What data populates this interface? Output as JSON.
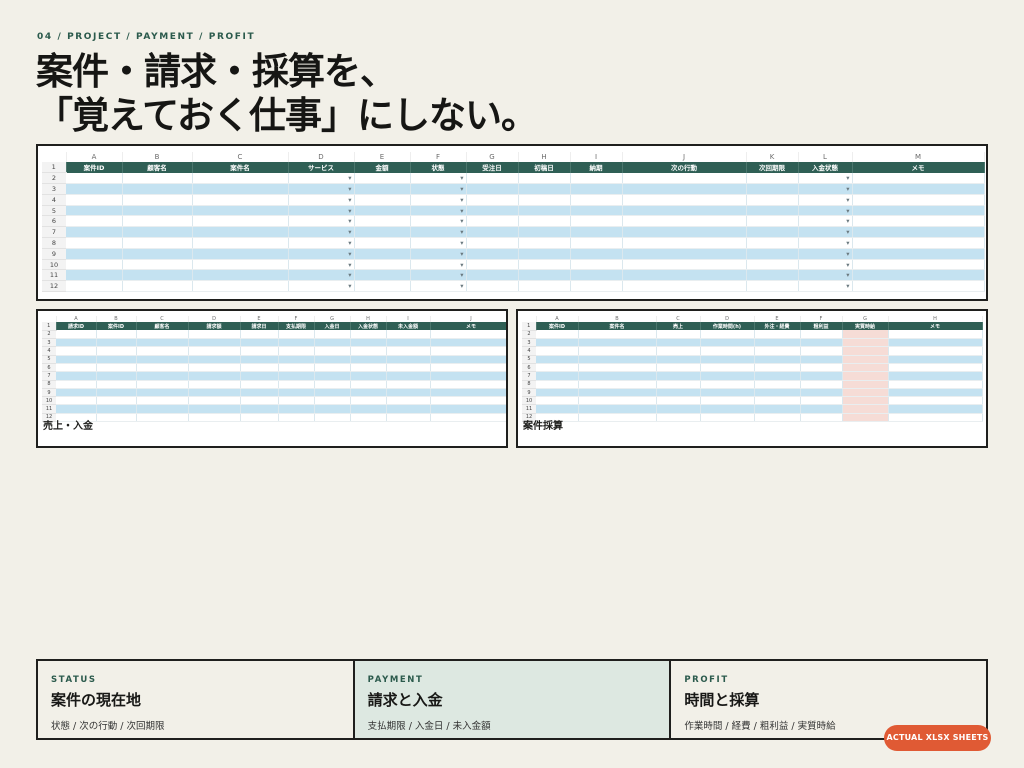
{
  "eyebrow": "04 / PROJECT / PAYMENT / PROFIT",
  "title": {
    "line1": "案件・請求・採算を、",
    "line2": "「覚えておく仕事」にしない。"
  },
  "main_sheet": {
    "column_letters": [
      "A",
      "B",
      "C",
      "D",
      "E",
      "F",
      "G",
      "H",
      "I",
      "J",
      "K",
      "L",
      "M"
    ],
    "headers": [
      "案件ID",
      "顧客名",
      "案件名",
      "サービス",
      "金額",
      "状態",
      "受注日",
      "初稿日",
      "納期",
      "次の行動",
      "次回期限",
      "入金状態",
      "メモ"
    ],
    "row_numbers": [
      "1",
      "2",
      "3",
      "4",
      "5",
      "6",
      "7",
      "8",
      "9",
      "10",
      "11",
      "12"
    ],
    "dropdown_marker": "▾",
    "dropdown_columns": [
      "サービス",
      "状態",
      "入金状態"
    ]
  },
  "sales_sheet": {
    "label": "売上・入金",
    "column_letters": [
      "A",
      "B",
      "C",
      "D",
      "E",
      "F",
      "G",
      "H",
      "I",
      "J"
    ],
    "headers": [
      "請求ID",
      "案件ID",
      "顧客名",
      "請求額",
      "請求日",
      "支払期限",
      "入金日",
      "入金状態",
      "未入金額",
      "メモ"
    ],
    "row_numbers": [
      "1",
      "2",
      "3",
      "4",
      "5",
      "6",
      "7",
      "8",
      "9",
      "10",
      "11",
      "12"
    ]
  },
  "profit_sheet": {
    "label": "案件採算",
    "column_letters": [
      "A",
      "B",
      "C",
      "D",
      "E",
      "F",
      "G",
      "H"
    ],
    "headers": [
      "案件ID",
      "案件名",
      "売上",
      "作業時間(h)",
      "外注・経費",
      "粗利益",
      "実質時給",
      "メモ"
    ],
    "row_numbers": [
      "1",
      "2",
      "3",
      "4",
      "5",
      "6",
      "7",
      "8",
      "9",
      "10",
      "11",
      "12"
    ],
    "highlight_column": "実質時給"
  },
  "cards": [
    {
      "tag": "STATUS",
      "title": "案件の現在地",
      "sub": "状態 / 次の行動 / 次回期限",
      "active": false
    },
    {
      "tag": "PAYMENT",
      "title": "請求と入金",
      "sub": "支払期限 / 入金日 / 未入金額",
      "active": true
    },
    {
      "tag": "PROFIT",
      "title": "時間と採算",
      "sub": "作業時間 / 経費 / 粗利益 / 実質時給",
      "active": false
    }
  ],
  "badge": "ACTUAL XLSX SHEETS",
  "colors": {
    "background": "#f2f0e8",
    "header_green": "#2f5f55",
    "band_blue": "#c4e2f1",
    "highlight_peach": "#f6dcd6",
    "accent_orange": "#e05a34",
    "active_card": "#dde8e1"
  }
}
